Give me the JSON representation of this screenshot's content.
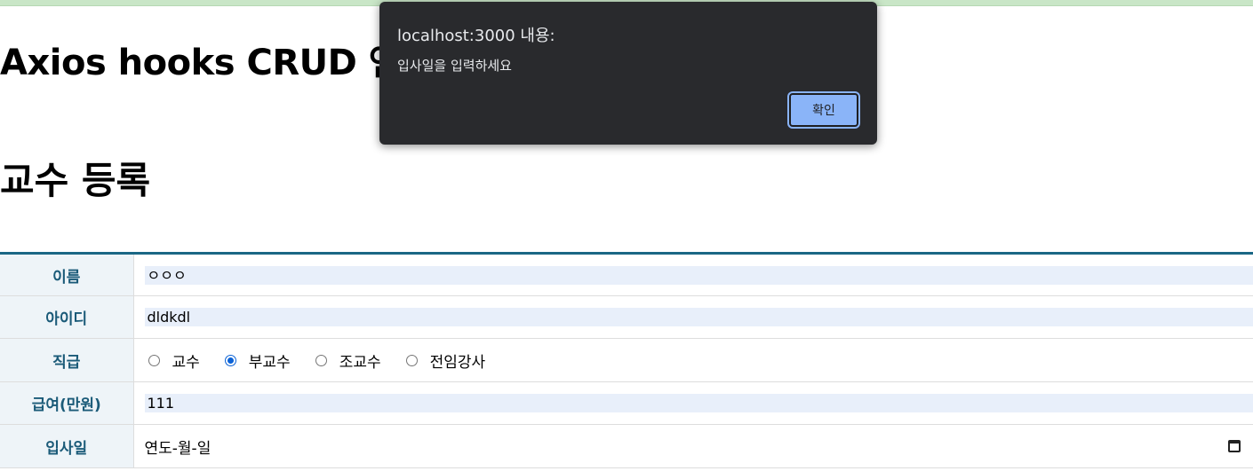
{
  "page": {
    "app_title": "Axios hooks CRUD 연습",
    "form_title": "교수 등록"
  },
  "form": {
    "rows": [
      {
        "label": "이름",
        "value": "ㅇㅇㅇ"
      },
      {
        "label": "아이디",
        "value": "dldkdl"
      },
      {
        "label": "직급"
      },
      {
        "label": "급여(만원)",
        "value": "111"
      },
      {
        "label": "입사일",
        "placeholder": "연도-월-일"
      }
    ],
    "rank_options": [
      "교수",
      "부교수",
      "조교수",
      "전임강사"
    ],
    "rank_selected": "부교수"
  },
  "alert": {
    "origin": "localhost:3000 내용:",
    "message": "입사일을 입력하세요",
    "ok_label": "확인",
    "ok_color": "#8ab4f8",
    "background": "#292a2d"
  },
  "colors": {
    "table_accent": "#1a6785",
    "label_text": "#1a5a78",
    "input_fill": "#e8effa",
    "radio_checked": "#0b62d6"
  },
  "icons": {
    "date_picker": "calendar-icon"
  }
}
